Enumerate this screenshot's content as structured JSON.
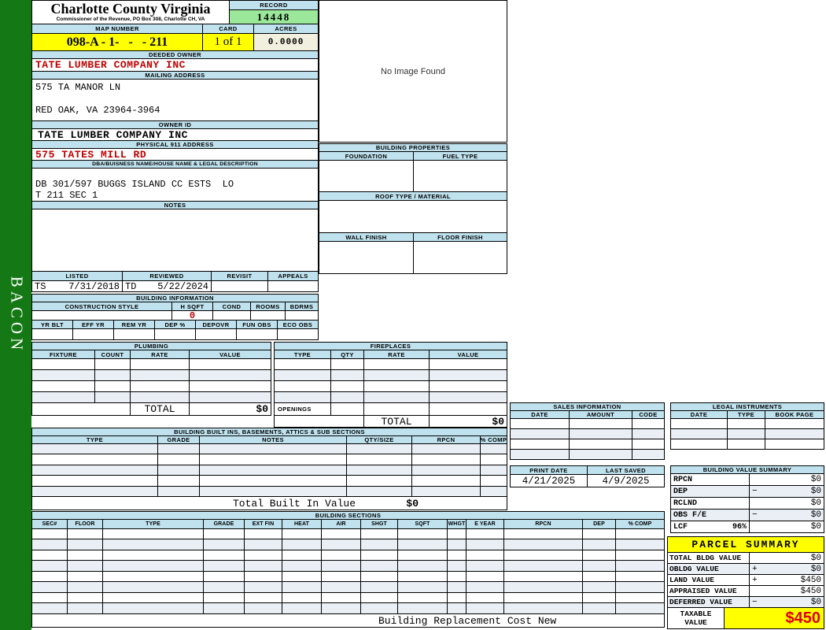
{
  "sidebar": {
    "vertical_label": "BACON"
  },
  "header": {
    "county_title": "Charlotte County Virginia",
    "county_subtitle": "Commissioner of the Revenue, PO Box 308, Charlotte CH, VA",
    "record_label": "RECORD",
    "record_value": "14448",
    "map_number_label": "MAP NUMBER",
    "map_number_value": "098-A - 1-   -   - 211",
    "card_label": "CARD",
    "card_value": "1 of 1",
    "acres_label": "ACRES",
    "acres_value": "0.0000"
  },
  "owner": {
    "deeded_owner_label": "DEEDED OWNER",
    "deeded_owner": "TATE LUMBER COMPANY INC",
    "mailing_address_label": "MAILING ADDRESS",
    "mailing_line1": "575 TA MANOR LN",
    "mailing_line2": "RED OAK, VA 23964-3964",
    "owner_id_label": "OWNER ID",
    "owner_id": "TATE LUMBER COMPANY INC",
    "physical_address_label": "PHYSICAL 911 ADDRESS",
    "physical_address": "575 TATES MILL RD",
    "dba_label": "DBA/BUISNESS NAME/HOUSE NAME & LEGAL DESCRIPTION",
    "legal_line1": "DB 301/597 BUGGS ISLAND CC ESTS  LO",
    "legal_line2": "T 211 SEC 1",
    "notes_label": "NOTES"
  },
  "visit": {
    "listed_label": "LISTED",
    "reviewed_label": "REVIEWED",
    "revisit_label": "REVISIT",
    "appeals_label": "APPEALS",
    "listed_by": "TS",
    "listed_date": "7/31/2018",
    "reviewed_by": "TD",
    "reviewed_date": "5/22/2024"
  },
  "image_panel": {
    "placeholder": "No Image Found"
  },
  "building_properties": {
    "title": "BUILDING PROPERTIES",
    "foundation_label": "FOUNDATION",
    "fuel_type_label": "FUEL TYPE",
    "roof_label": "ROOF TYPE / MATERIAL",
    "wall_finish_label": "WALL FINISH",
    "floor_finish_label": "FLOOR FINISH"
  },
  "building_information": {
    "title": "BUILDING INFORMATION",
    "row1_headers": [
      "CONSTRUCTION STYLE",
      "H SQFT",
      "COND",
      "ROOMS",
      "BDRMS"
    ],
    "h_sqft_value": "0",
    "row2_headers": [
      "YR BLT",
      "EFF YR",
      "REM YR",
      "DEP %",
      "DEPOVR",
      "FUN OBS",
      "ECO OBS"
    ]
  },
  "plumbing": {
    "title": "PLUMBING",
    "headers": [
      "FIXTURE",
      "COUNT",
      "RATE",
      "VALUE"
    ],
    "total_label": "TOTAL",
    "total_value": "$0"
  },
  "fireplaces": {
    "title": "FIREPLACES",
    "headers": [
      "TYPE",
      "QTY",
      "RATE",
      "VALUE"
    ],
    "openings_label": "OPENINGS",
    "total_label": "TOTAL",
    "total_value": "$0"
  },
  "built_ins": {
    "title": "BUILDING BUILT INS, BASEMENTS, ATTICS & SUB SECTIONS",
    "headers": [
      "TYPE",
      "GRADE",
      "NOTES",
      "QTY/SIZE",
      "RPCN",
      "% COMP"
    ],
    "total_label": "Total Built In Value",
    "total_value": "$0"
  },
  "building_sections": {
    "title": "BUILDING SECTIONS",
    "headers": [
      "SEC#",
      "FLOOR",
      "TYPE",
      "GRADE",
      "EXT FIN",
      "HEAT",
      "AIR",
      "SHGT",
      "SQFT",
      "WHGT",
      "E YEAR",
      "RPCN",
      "DEP",
      "% COMP"
    ],
    "footer_label": "Building Replacement Cost New"
  },
  "sales_information": {
    "title": "SALES INFORMATION",
    "headers": [
      "DATE",
      "AMOUNT",
      "CODE"
    ]
  },
  "legal_instruments": {
    "title": "LEGAL INSTRUMENTS",
    "headers": [
      "DATE",
      "TYPE",
      "BOOK PAGE"
    ]
  },
  "print_info": {
    "print_date_label": "PRINT DATE",
    "print_date": "4/21/2025",
    "last_saved_label": "LAST SAVED",
    "last_saved": "4/9/2025"
  },
  "building_value_summary": {
    "title": "BUILDING VALUE SUMMARY",
    "rows": [
      {
        "label": "RPCN",
        "pct": "",
        "op": "",
        "value": "$0"
      },
      {
        "label": "DEP",
        "pct": "",
        "op": "−",
        "value": "$0"
      },
      {
        "label": "RCLND",
        "pct": "",
        "op": "",
        "value": "$0"
      },
      {
        "label": "OBS F/E",
        "pct": "",
        "op": "−",
        "value": "$0"
      },
      {
        "label": "LCF",
        "pct": "96%",
        "op": "",
        "value": "$0"
      }
    ]
  },
  "parcel_summary": {
    "title": "PARCEL SUMMARY",
    "rows": [
      {
        "label": "TOTAL BLDG VALUE",
        "op": "",
        "value": "$0"
      },
      {
        "label": "OBLDG VALUE",
        "op": "+",
        "value": "$0"
      },
      {
        "label": "LAND VALUE",
        "op": "+",
        "value": "$450"
      },
      {
        "label": "APPRAISED VALUE",
        "op": "",
        "value": "$450"
      },
      {
        "label": "DEFERRED VALUE",
        "op": "−",
        "value": "$0"
      }
    ],
    "taxable_label": "TAXABLE VALUE",
    "taxable_value": "$450"
  },
  "colors": {
    "header_fill": "#BFE2EE",
    "highlight_yellow": "#FFFF00",
    "record_green": "#9BE89B",
    "acres_cream": "#F1EFDE",
    "sidebar_green": "#147814",
    "alert_red": "#C00000",
    "taxable_red": "#DD0000"
  }
}
